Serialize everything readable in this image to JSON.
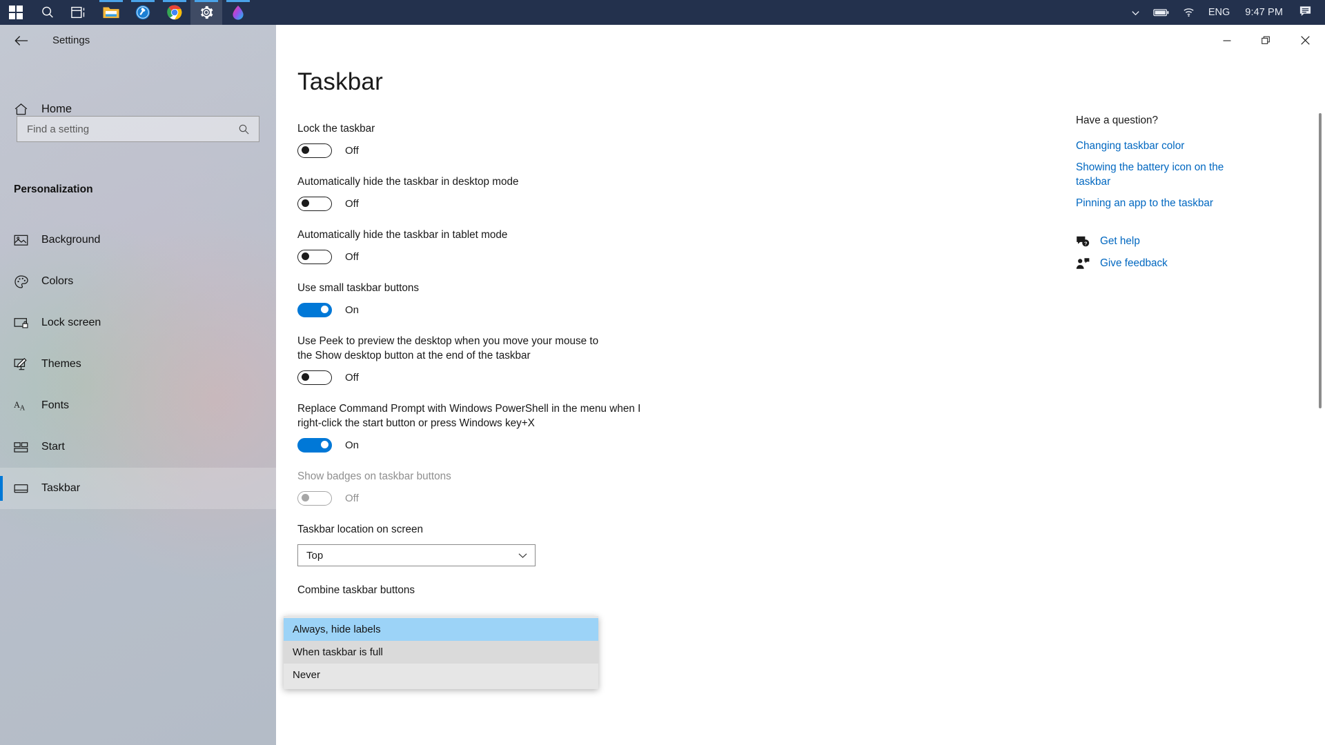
{
  "taskbar": {
    "buttons": [
      {
        "name": "start-button",
        "icon": "windows-logo-icon"
      },
      {
        "name": "search-button",
        "icon": "search-icon"
      },
      {
        "name": "task-view-button",
        "icon": "task-view-icon"
      },
      {
        "name": "file-explorer-button",
        "icon": "folder-icon"
      },
      {
        "name": "edge-button",
        "icon": "edge-browser-icon"
      },
      {
        "name": "chrome-button",
        "icon": "chrome-browser-icon"
      },
      {
        "name": "settings-button",
        "icon": "gear-icon"
      },
      {
        "name": "paint-button",
        "icon": "paint-drop-icon"
      }
    ],
    "tray": {
      "overflow_icon": "chevron-up-icon",
      "battery_icon": "battery-icon",
      "network_icon": "wifi-icon",
      "language": "ENG",
      "time": "9:47 PM",
      "notification_icon": "notification-chat-icon"
    }
  },
  "window": {
    "title": "Settings",
    "back_icon": "back-arrow-icon",
    "minimize_label": "—",
    "restore_icon": "restore-icon",
    "close_label": "✕"
  },
  "sidebar": {
    "home_label": "Home",
    "home_icon": "home-icon",
    "search": {
      "placeholder": "Find a setting",
      "value": "",
      "icon": "search-icon"
    },
    "category": "Personalization",
    "items": [
      {
        "label": "Background",
        "icon": "picture-icon",
        "selected": false
      },
      {
        "label": "Colors",
        "icon": "palette-icon",
        "selected": false
      },
      {
        "label": "Lock screen",
        "icon": "lock-screen-icon",
        "selected": false
      },
      {
        "label": "Themes",
        "icon": "themes-brush-icon",
        "selected": false
      },
      {
        "label": "Fonts",
        "icon": "fonts-icon",
        "selected": false
      },
      {
        "label": "Start",
        "icon": "start-tiles-icon",
        "selected": false
      },
      {
        "label": "Taskbar",
        "icon": "taskbar-icon",
        "selected": true
      }
    ]
  },
  "main": {
    "page_title": "Taskbar",
    "settings": [
      {
        "label": "Lock the taskbar",
        "state": "Off",
        "on": false,
        "disabled": false
      },
      {
        "label": "Automatically hide the taskbar in desktop mode",
        "state": "Off",
        "on": false,
        "disabled": false
      },
      {
        "label": "Automatically hide the taskbar in tablet mode",
        "state": "Off",
        "on": false,
        "disabled": false
      },
      {
        "label": "Use small taskbar buttons",
        "state": "On",
        "on": true,
        "disabled": false
      },
      {
        "label": "Use Peek to preview the desktop when you move your mouse to the Show desktop button at the end of the taskbar",
        "state": "Off",
        "on": false,
        "disabled": false
      },
      {
        "label": "Replace Command Prompt with Windows PowerShell in the menu when I right-click the start button or press Windows key+X",
        "state": "On",
        "on": true,
        "disabled": false
      },
      {
        "label": "Show badges on taskbar buttons",
        "state": "Off",
        "on": false,
        "disabled": true
      }
    ],
    "location_setting": {
      "label": "Taskbar location on screen",
      "value": "Top",
      "chevron_icon": "chevron-down-icon"
    },
    "combine_setting": {
      "label": "Combine taskbar buttons",
      "options": [
        {
          "label": "Always, hide labels",
          "state": "selected"
        },
        {
          "label": "When taskbar is full",
          "state": "hover"
        },
        {
          "label": "Never",
          "state": "normal"
        }
      ]
    }
  },
  "help": {
    "title": "Have a question?",
    "links": [
      "Changing taskbar color",
      "Showing the battery icon on the taskbar",
      "Pinning an app to the taskbar"
    ],
    "actions": [
      {
        "label": "Get help",
        "icon": "help-question-icon"
      },
      {
        "label": "Give feedback",
        "icon": "feedback-person-icon"
      }
    ]
  },
  "colors": {
    "accent": "#0078d7",
    "link": "#0067c0",
    "taskbar_bg": "#23314d",
    "dropdown_selected": "#9cd3f7"
  }
}
